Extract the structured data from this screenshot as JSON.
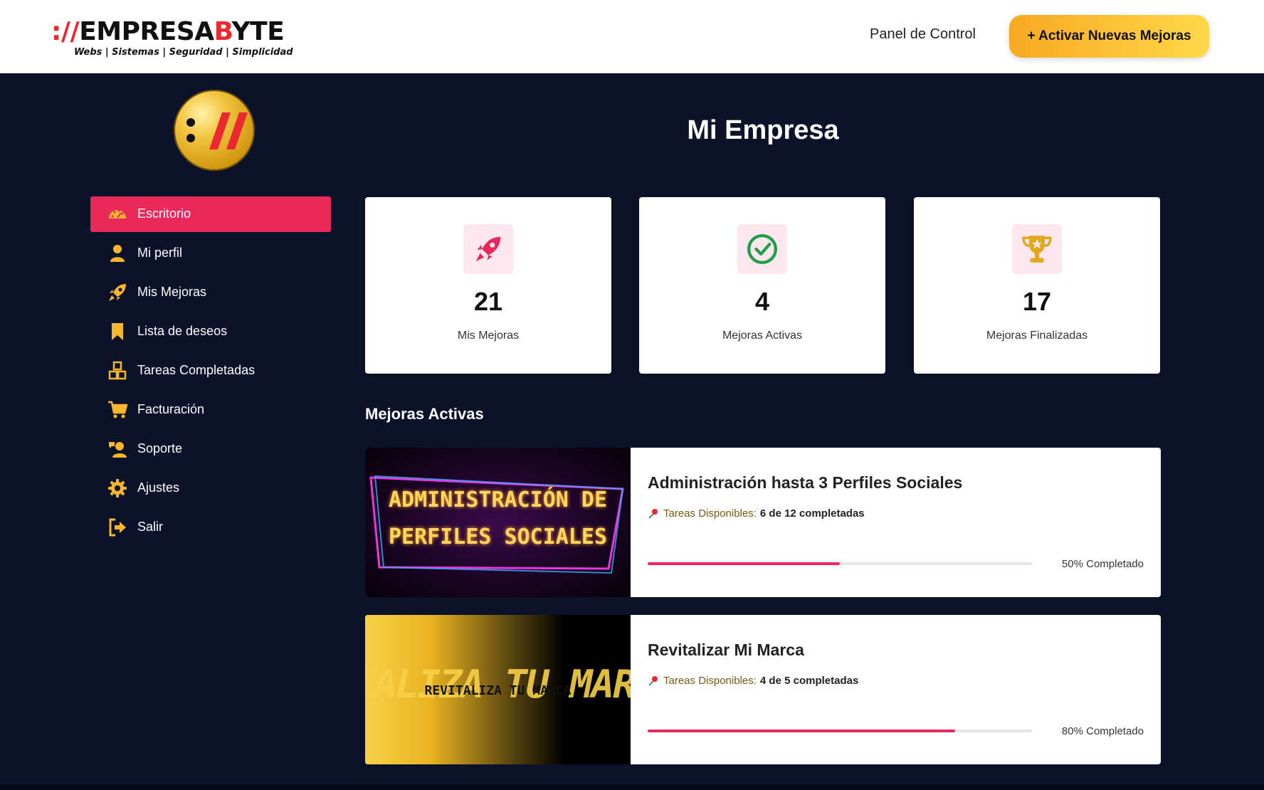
{
  "header": {
    "logo_prefix": "://",
    "logo_name_1": "EMPRESA",
    "logo_name_2": "B",
    "logo_name_3": "YTE",
    "logo_tagline": "Webs | Sistemas | Seguridad | Simplicidad",
    "nav_link": "Panel de Control",
    "cta_label": "+ Activar Nuevas Mejoras"
  },
  "colors": {
    "accent": "#e8295a",
    "brand_yellow": "#f7b62c",
    "background": "#0b1229"
  },
  "sidebar": {
    "items": [
      {
        "label": "Escritorio",
        "icon": "dashboard-gauge-icon",
        "active": true
      },
      {
        "label": "Mi perfil",
        "icon": "user-icon",
        "active": false
      },
      {
        "label": "Mis Mejoras",
        "icon": "rocket-icon",
        "active": false
      },
      {
        "label": "Lista de deseos",
        "icon": "bookmark-icon",
        "active": false
      },
      {
        "label": "Tareas Completadas",
        "icon": "boxes-icon",
        "active": false
      },
      {
        "label": "Facturación",
        "icon": "cart-icon",
        "active": false
      },
      {
        "label": "Soporte",
        "icon": "support-icon",
        "active": false
      },
      {
        "label": "Ajustes",
        "icon": "gear-icon",
        "active": false
      },
      {
        "label": "Salir",
        "icon": "sign-out-icon",
        "active": false
      }
    ]
  },
  "main": {
    "title": "Mi Empresa",
    "stats": [
      {
        "value": "21",
        "label": "Mis Mejoras",
        "icon": "rocket-icon"
      },
      {
        "value": "4",
        "label": "Mejoras Activas",
        "icon": "check-circle-icon"
      },
      {
        "value": "17",
        "label": "Mejoras Finalizadas",
        "icon": "trophy-icon"
      }
    ],
    "section_title": "Mejoras Activas",
    "mejoras": [
      {
        "title": "Administración hasta 3 Perfiles Sociales",
        "tasks_label": "Tareas Disponibles:",
        "tasks_value": "6 de 12 completadas",
        "progress": 50,
        "progress_text": "50% Completado",
        "thumb_line1": "ADMINISTRACIÓN DE",
        "thumb_line2": "PERFILES SOCIALES"
      },
      {
        "title": "Revitalizar Mi Marca",
        "tasks_label": "Tareas Disponibles:",
        "tasks_value": "4 de 5 completadas",
        "progress": 80,
        "progress_text": "80% Completado",
        "thumb_line1": "REVITALIZA TU MARCA",
        "thumb_line2": "TALIZA TU MAR"
      }
    ]
  }
}
